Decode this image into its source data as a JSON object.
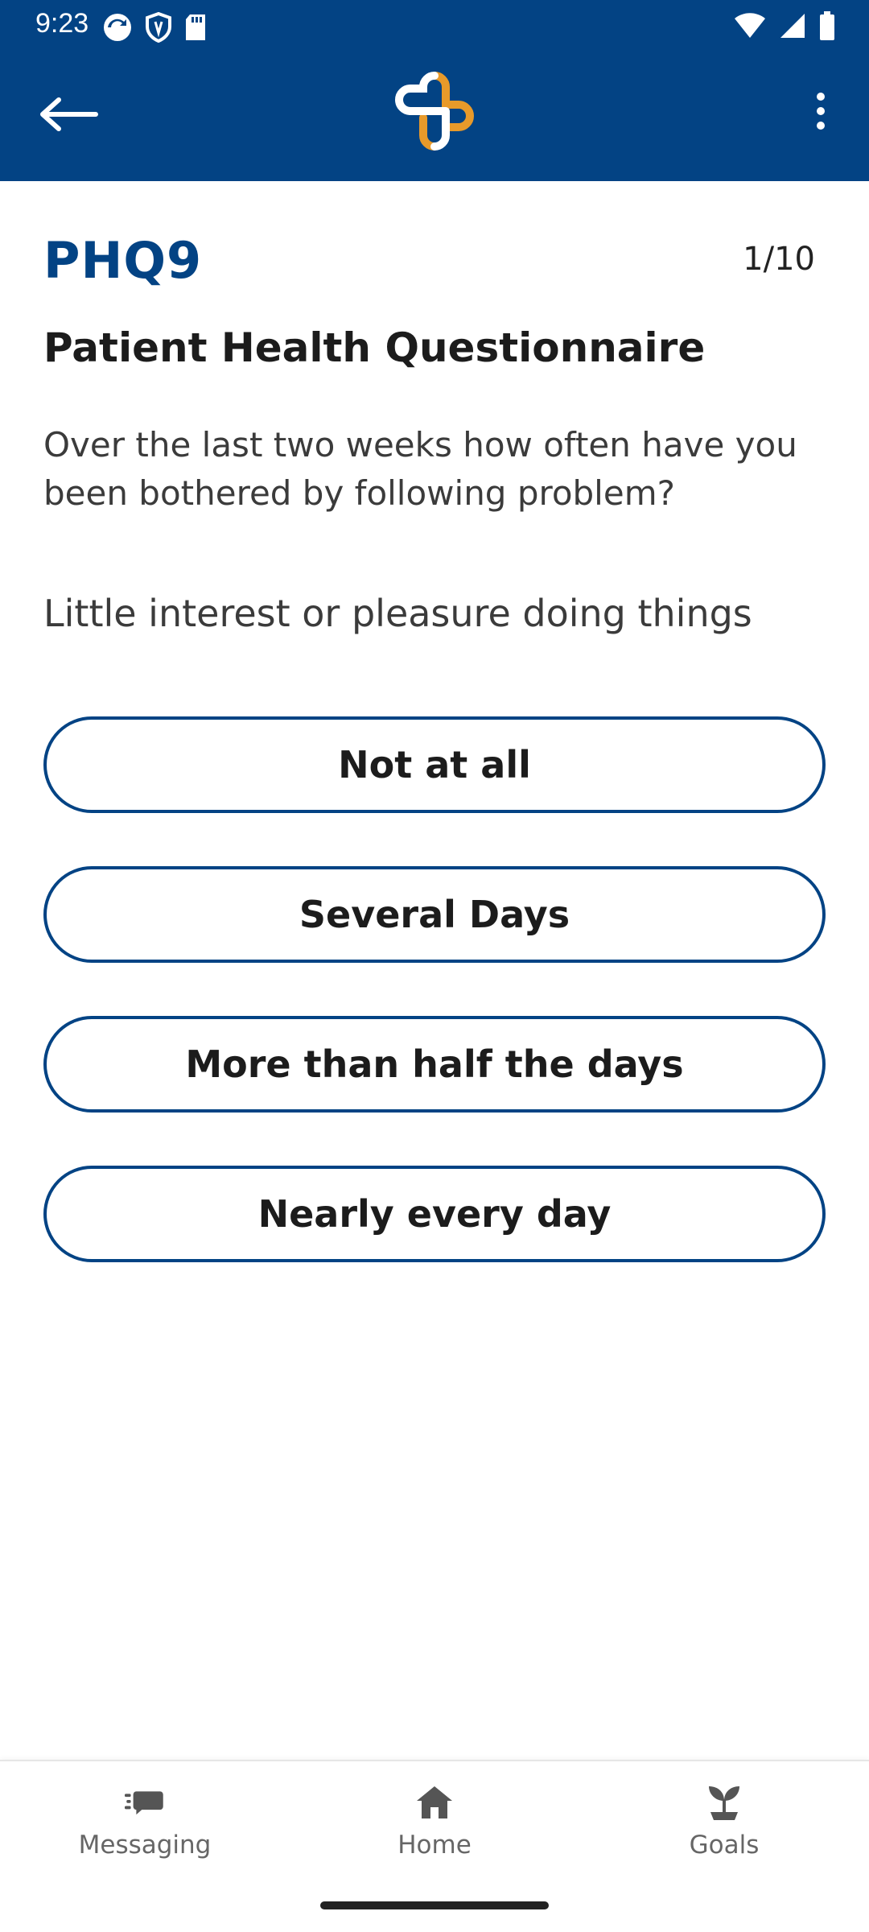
{
  "status_bar": {
    "time": "9:23",
    "left_icons": [
      "sync-icon",
      "vpn-shield-icon",
      "sd-card-icon"
    ],
    "right_icons": [
      "wifi-icon",
      "signal-icon",
      "battery-icon"
    ]
  },
  "app_bar": {
    "back_icon": "arrow-left-icon",
    "logo_icon": "health-cross-logo",
    "menu_icon": "more-vertical-icon",
    "colors": {
      "primary": "#034384",
      "logo_accent": "#E89A2A"
    }
  },
  "questionnaire": {
    "code": "PHQ9",
    "counter": "1/10",
    "title": "Patient Health Questionnaire",
    "instructions": "Over the last two weeks how often have you been bothered by following problem?",
    "question": "Little interest or pleasure doing things",
    "answers": [
      {
        "label": "Not at all"
      },
      {
        "label": "Several Days"
      },
      {
        "label": "More than half the days"
      },
      {
        "label": "Nearly every day"
      }
    ]
  },
  "bottom_nav": {
    "items": [
      {
        "label": "Messaging",
        "icon": "messaging-icon"
      },
      {
        "label": "Home",
        "icon": "home-icon"
      },
      {
        "label": "Goals",
        "icon": "sprout-icon"
      }
    ]
  }
}
